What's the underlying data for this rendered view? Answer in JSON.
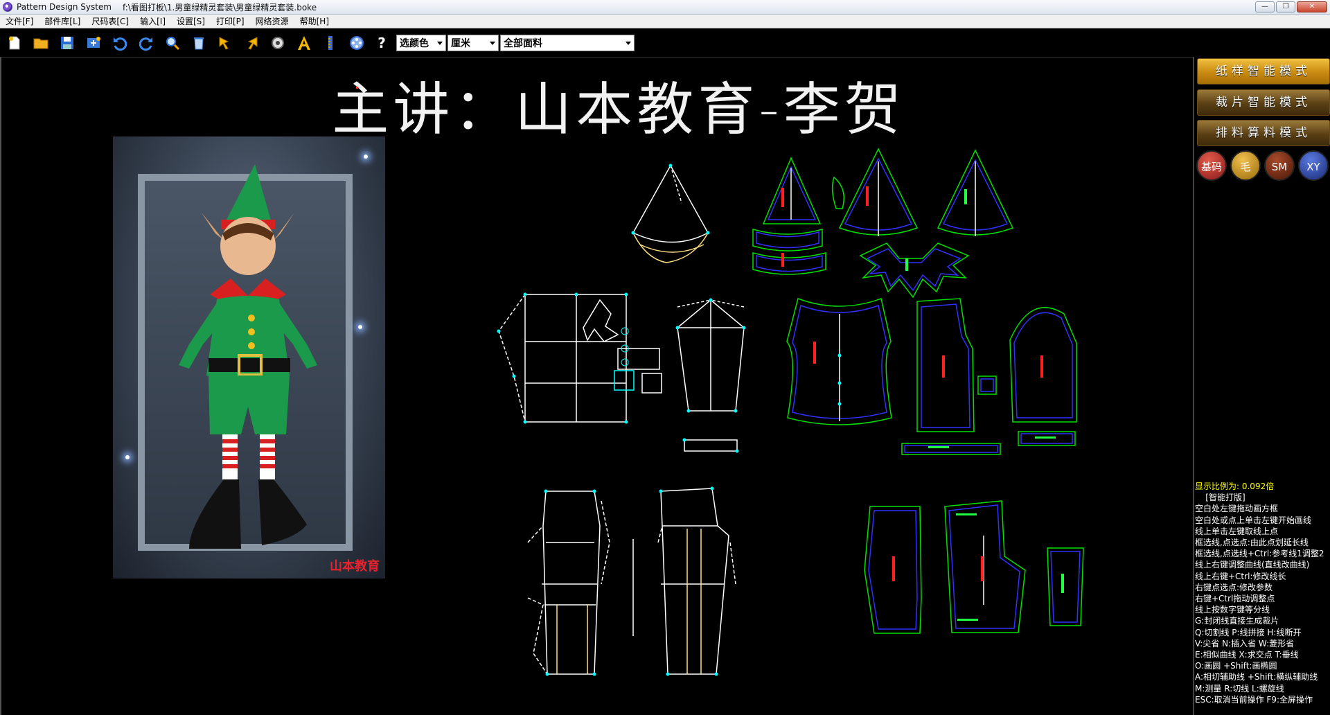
{
  "window": {
    "app_title": "Pattern Design System",
    "file_path": "f:\\看图打板\\1.男童绿精灵套装\\男童绿精灵套装.boke",
    "controls": [
      "—",
      "❐",
      "✕"
    ]
  },
  "menu": [
    {
      "label": "文件[F]"
    },
    {
      "label": "部件库[L]"
    },
    {
      "label": "尺码表[C]"
    },
    {
      "label": "输入[I]"
    },
    {
      "label": "设置[S]"
    },
    {
      "label": "打印[P]"
    },
    {
      "label": "网络资源"
    },
    {
      "label": "帮助[H]"
    }
  ],
  "toolbar": {
    "icons": [
      "new-file",
      "open-folder",
      "save",
      "import",
      "undo",
      "redo",
      "zoom",
      "recycle",
      "pointer-select",
      "pointer-adjust",
      "measure-tape",
      "text",
      "ruler",
      "film-reel"
    ],
    "help_label": "?",
    "color_select": "选颜色",
    "unit_select": "厘米",
    "fabric_select": "全部面料"
  },
  "canvas": {
    "title": "主讲：山本教育-李贺",
    "photo_watermark": "山本教育",
    "colors": {
      "draft": "#ffffff",
      "piece_outer": "#00e000",
      "piece_inner": "#3030ff",
      "point": "#00ffff",
      "label": "#ff2020"
    }
  },
  "right_panel": {
    "modes": [
      {
        "label": "纸样智能模式",
        "active": true
      },
      {
        "label": "裁片智能模式",
        "active": false
      },
      {
        "label": "排料算料模式",
        "active": false
      }
    ],
    "circle_buttons": [
      {
        "label": "基码",
        "color": "#b02a2a"
      },
      {
        "label": "毛",
        "color": "#c8901a"
      },
      {
        "label": "SM",
        "color": "#7a2a1a"
      },
      {
        "label": "XY",
        "color": "#2a4aa8"
      }
    ],
    "scale_text": "显示比例为: 0.092倍",
    "help_lines": [
      "    [智能打版]",
      "空白处左键拖动画方框",
      "空白处或点上单击左键开始画线",
      "线上单击左键取线上点",
      "框选线,点选点:由此点划延长线",
      "框选线,点选线+Ctrl:参考线1调整2",
      "线上右键调整曲线(直线改曲线)",
      "线上右键+Ctrl:修改线长",
      "右键点选点:修改参数",
      "右键+Ctrl拖动调整点",
      "线上按数字键等分线",
      "G:封闭线直接生成裁片",
      "Q:切割线  P:线拼接  H:线断开",
      "V:尖省  N:插入省  W:菱形省",
      "E:相似曲线  X:求交点  T:垂线",
      "O:画圆 +Shift:画椭圆",
      "A:相切辅助线 +Shift:横纵辅助线",
      "M:测量  R:切线  L:螺旋线",
      "ESC:取消当前操作  F9:全屏操作"
    ]
  }
}
